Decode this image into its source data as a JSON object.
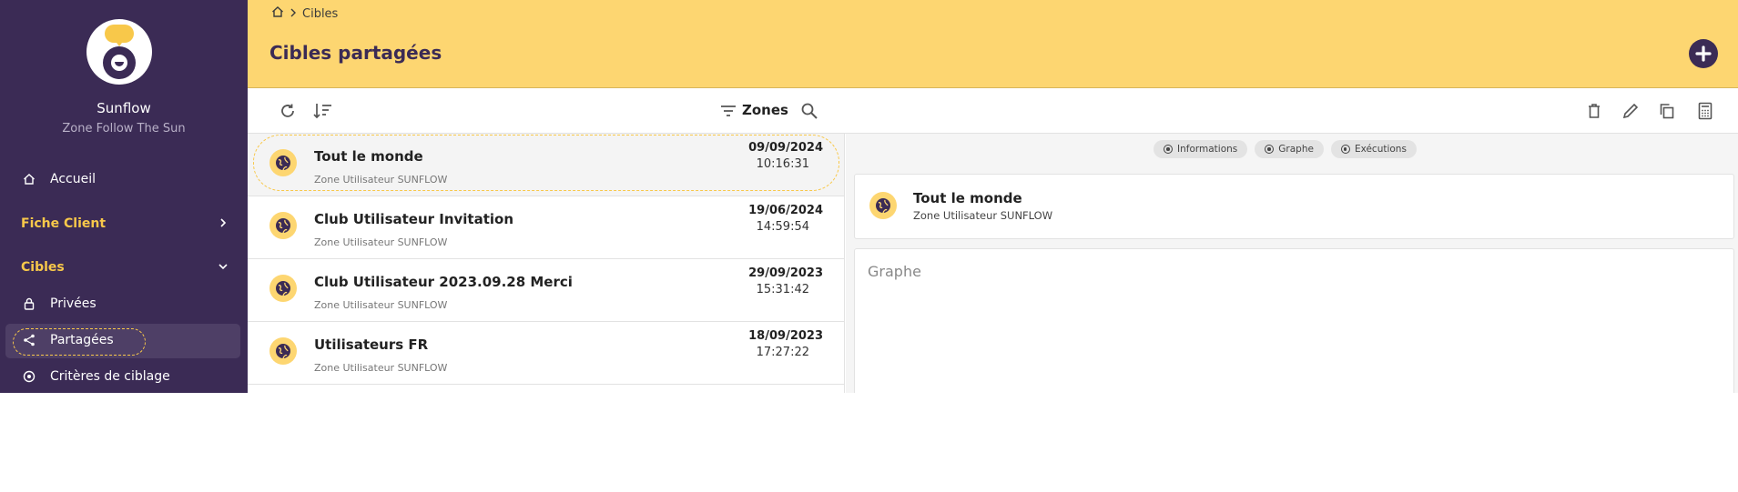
{
  "sidebar": {
    "brand": "Sunflow",
    "subtitle": "Zone Follow The Sun",
    "items": {
      "home": "Accueil",
      "fiche_client": "Fiche Client",
      "cibles": "Cibles",
      "privees": "Privées",
      "partagees": "Partagées",
      "criteres": "Critères de ciblage"
    }
  },
  "header": {
    "breadcrumb": "Cibles",
    "title": "Cibles partagées"
  },
  "toolbar": {
    "filter_label": "Zones"
  },
  "list": [
    {
      "name": "Tout le monde",
      "zone": "Zone Utilisateur SUNFLOW",
      "date": "09/09/2024",
      "time": "10:16:31"
    },
    {
      "name": "Club Utilisateur Invitation",
      "zone": "Zone Utilisateur SUNFLOW",
      "date": "19/06/2024",
      "time": "14:59:54"
    },
    {
      "name": "Club Utilisateur 2023.09.28 Merci",
      "zone": "Zone Utilisateur SUNFLOW",
      "date": "29/09/2023",
      "time": "15:31:42"
    },
    {
      "name": "Utilisateurs FR",
      "zone": "Zone Utilisateur SUNFLOW",
      "date": "18/09/2023",
      "time": "17:27:22"
    }
  ],
  "detail": {
    "tabs": [
      "Informations",
      "Graphe",
      "Exécutions"
    ],
    "title": "Tout le monde",
    "subtitle": "Zone Utilisateur SUNFLOW",
    "graph_title": "Graphe"
  },
  "colors": {
    "sidebar": "#3b2b55",
    "accent": "#fdd671",
    "section": "#f8c84a"
  },
  "icons": {
    "refresh": "refresh-icon",
    "sort": "sort-icon",
    "filter": "filter-icon",
    "search": "search-icon",
    "delete": "trash-icon",
    "edit": "pencil-icon",
    "copy": "copy-icon",
    "calc": "calculator-icon",
    "globe": "globe-icon"
  }
}
